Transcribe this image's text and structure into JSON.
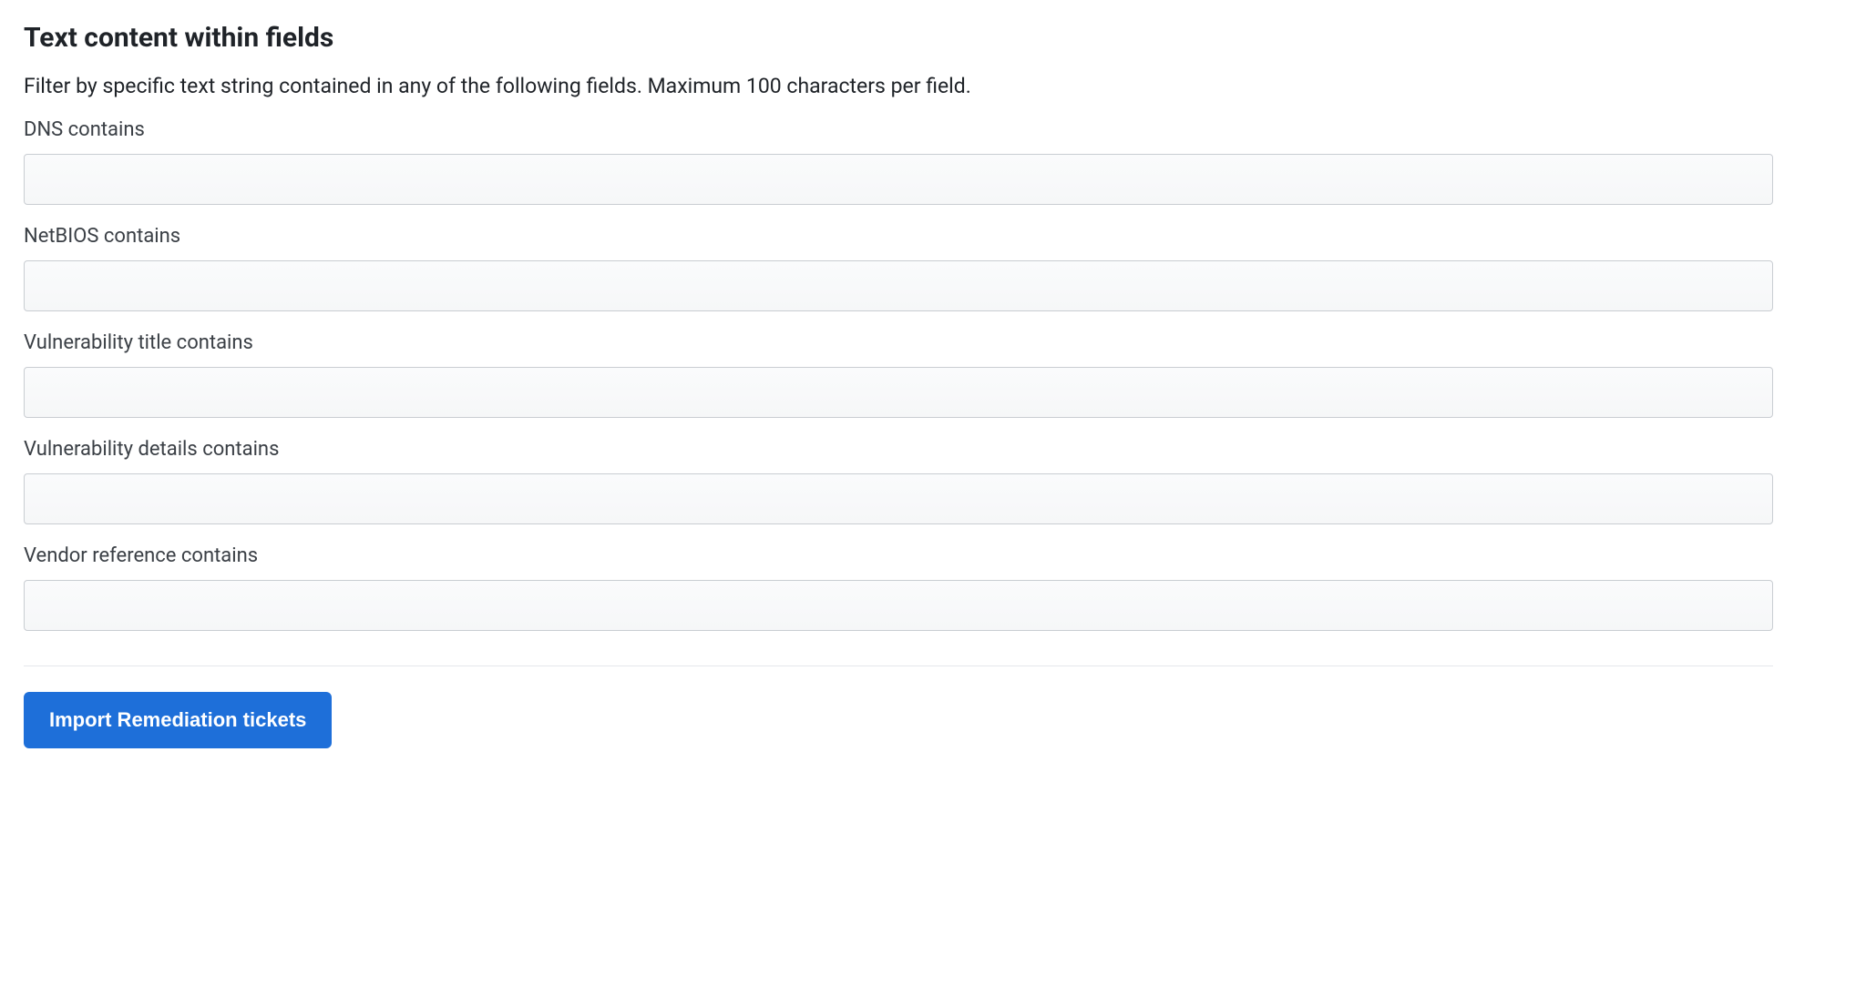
{
  "section": {
    "title": "Text content within fields",
    "description": "Filter by specific text string contained in any of the following fields. Maximum 100 characters per field."
  },
  "fields": {
    "dns": {
      "label": "DNS contains",
      "value": "",
      "placeholder": ""
    },
    "netbios": {
      "label": "NetBIOS contains",
      "value": "",
      "placeholder": ""
    },
    "vuln_title": {
      "label": "Vulnerability title contains",
      "value": "",
      "placeholder": ""
    },
    "vuln_details": {
      "label": "Vulnerability details contains",
      "value": "",
      "placeholder": ""
    },
    "vendor_ref": {
      "label": "Vendor reference contains",
      "value": "",
      "placeholder": ""
    }
  },
  "actions": {
    "import_label": "Import Remediation tickets"
  }
}
